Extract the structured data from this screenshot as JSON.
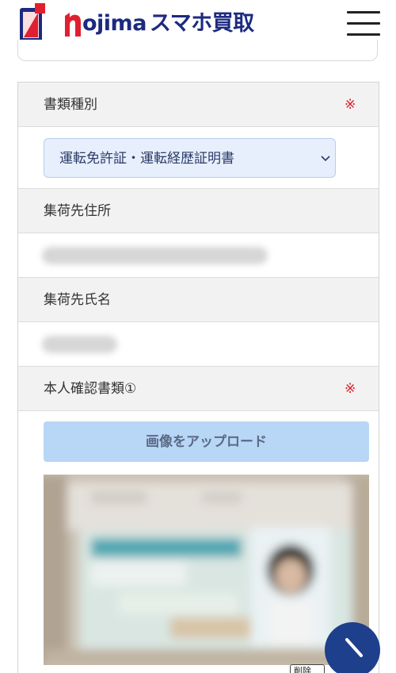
{
  "header": {
    "brand_name": "ojima",
    "service_name": "スマホ買取",
    "logo_icon": "smartphone-logo-icon",
    "menu_icon": "hamburger-menu-icon",
    "brand_color": "#1c2a80",
    "accent_color": "#e02030"
  },
  "form": {
    "document_type": {
      "label": "書類種別",
      "required_mark": "※",
      "selected_value": "運転免許証・運転経歴証明書"
    },
    "pickup_address": {
      "label": "集荷先住所"
    },
    "pickup_name": {
      "label": "集荷先氏名"
    },
    "identity_document": {
      "label": "本人確認書類①",
      "required_mark": "※",
      "upload_label": "画像をアップロード",
      "delete_label": "削除"
    }
  },
  "colors": {
    "row_header_bg": "#f2f2f2",
    "select_bg": "#e7effd",
    "upload_button_bg": "#b8d6f6",
    "required_color": "#e0202a",
    "fab_color": "#1e3f8c"
  }
}
